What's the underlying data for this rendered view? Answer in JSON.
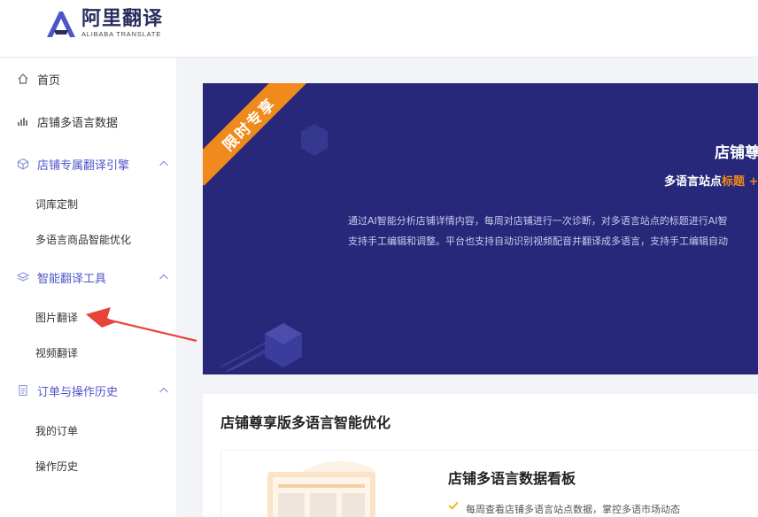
{
  "brand": {
    "name_cn": "阿里翻译",
    "name_en": "ALIBABA TRANSLATE",
    "color": "#4f55c8"
  },
  "sidebar": {
    "items": [
      {
        "label": "首页",
        "icon": "home-icon"
      },
      {
        "label": "店铺多语言数据",
        "icon": "bar-chart-icon"
      },
      {
        "label": "店铺专属翻译引擎",
        "icon": "cube-icon",
        "expanded": true,
        "children": [
          "词库定制",
          "多语言商品智能优化"
        ]
      },
      {
        "label": "智能翻译工具",
        "icon": "layers-icon",
        "expanded": true,
        "children": [
          "图片翻译",
          "视频翻译"
        ]
      },
      {
        "label": "订单与操作历史",
        "icon": "document-icon",
        "expanded": true,
        "children": [
          "我的订单",
          "操作历史"
        ]
      }
    ]
  },
  "banner": {
    "ribbon": "限时专享",
    "title": "店铺尊",
    "subtitle_prefix": "多语言站点",
    "subtitle_highlight": "标题",
    "subtitle_suffix": " +",
    "desc_line1": "通过AI智能分析店铺详情内容，每周对店铺进行一次诊断，对多语言站点的标题进行AI智",
    "desc_line2": "支持手工编辑和调整。平台也支持自动识别视频配音并翻译成多语言，支持手工编辑自动",
    "bg_color": "#27287a",
    "accent_color": "#f08a1c"
  },
  "section": {
    "title": "店铺尊享版多语言智能优化",
    "feature": {
      "title": "店铺多语言数据看板",
      "points": [
        "每周查看店铺多语言站点数据，掌控多语市场动态"
      ]
    }
  },
  "annotation": {
    "arrow_color": "#e8443a",
    "points_to": "图片翻译"
  }
}
